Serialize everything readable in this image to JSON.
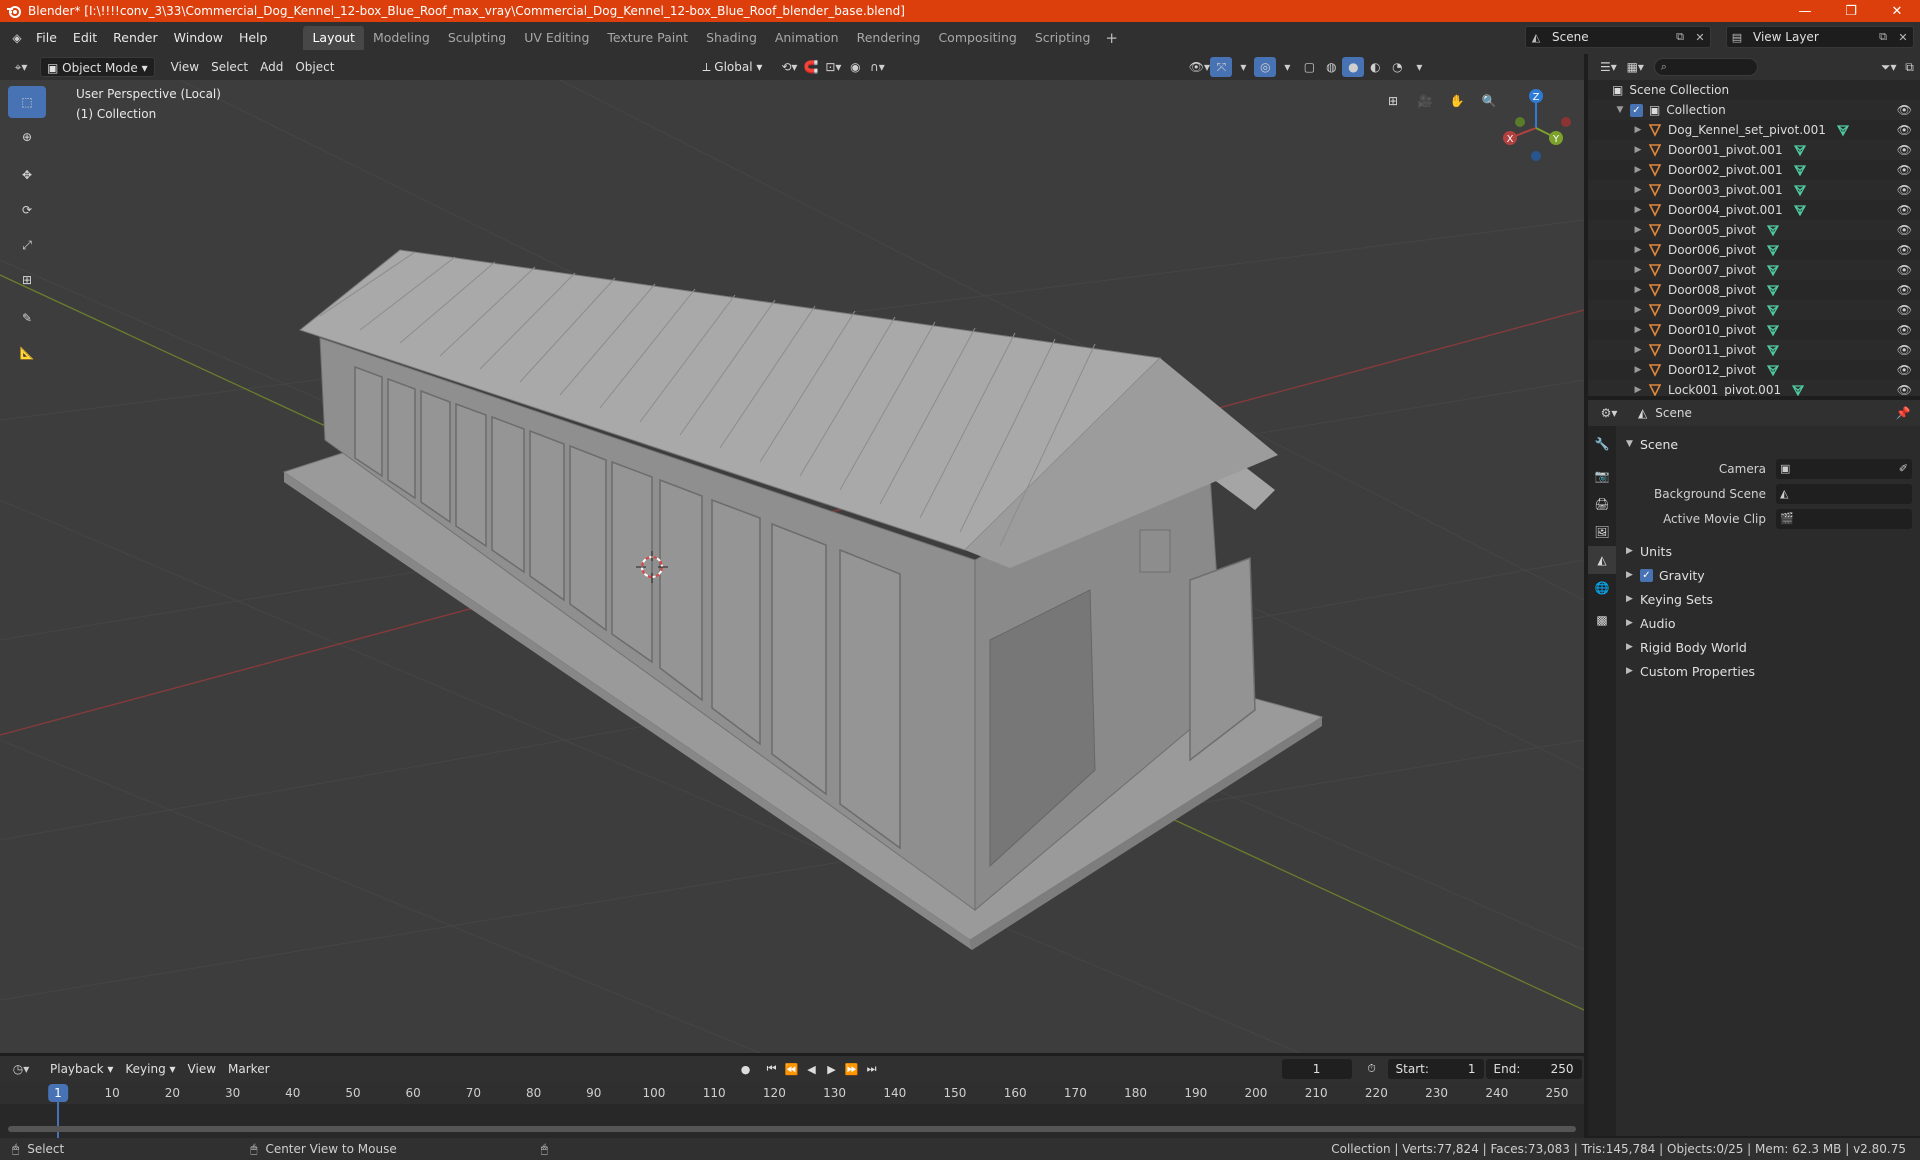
{
  "window": {
    "title": "Blender* [I:\\!!!!conv_3\\33\\Commercial_Dog_Kennel_12-box_Blue_Roof_max_vray\\Commercial_Dog_Kennel_12-box_Blue_Roof_blender_base.blend]",
    "controls": [
      "minimize",
      "maximize",
      "close"
    ]
  },
  "menubar": {
    "menus": [
      "File",
      "Edit",
      "Render",
      "Window",
      "Help"
    ],
    "workspaces": [
      "Layout",
      "Modeling",
      "Sculpting",
      "UV Editing",
      "Texture Paint",
      "Shading",
      "Animation",
      "Rendering",
      "Compositing",
      "Scripting"
    ],
    "active_workspace": "Layout",
    "scene": "Scene",
    "view_layer": "View Layer"
  },
  "viewport_header": {
    "mode": "Object Mode",
    "menus": [
      "View",
      "Select",
      "Add",
      "Object"
    ],
    "transform_orientation": "Global"
  },
  "viewport": {
    "perspective_label": "User Perspective (Local)",
    "collection_label": "(1) Collection",
    "tools": [
      "select-box",
      "cursor",
      "move",
      "rotate",
      "scale",
      "transform",
      "annotate",
      "measure"
    ],
    "gizmo_axes": [
      "X",
      "Y",
      "Z"
    ],
    "colors": {
      "background": "#3d3d3d",
      "x_axis": "#b3413f",
      "y_axis": "#7da22c",
      "z_axis": "#2e7bd6",
      "active": "#4772b3"
    }
  },
  "outliner": {
    "search_placeholder": "",
    "root": "Scene Collection",
    "collection": "Collection",
    "items": [
      "Dog_Kennel_set_pivot.001",
      "Door001_pivot.001",
      "Door002_pivot.001",
      "Door003_pivot.001",
      "Door004_pivot.001",
      "Door005_pivot",
      "Door006_pivot",
      "Door007_pivot",
      "Door008_pivot",
      "Door009_pivot",
      "Door010_pivot",
      "Door011_pivot",
      "Door012_pivot",
      "Lock001_pivot.001"
    ]
  },
  "properties": {
    "context": "Scene",
    "panel": "Scene",
    "fields": [
      {
        "label": "Camera"
      },
      {
        "label": "Background Scene"
      },
      {
        "label": "Active Movie Clip"
      }
    ],
    "subpanels": [
      "Units",
      "Gravity",
      "Keying Sets",
      "Audio",
      "Rigid Body World",
      "Custom Properties"
    ],
    "gravity_enabled": true
  },
  "timeline": {
    "menus": [
      "Playback",
      "Keying",
      "View",
      "Marker"
    ],
    "current_frame": "1",
    "start_label": "Start:",
    "start": "1",
    "end_label": "End:",
    "end": "250",
    "ticks": [
      "10",
      "20",
      "30",
      "40",
      "50",
      "60",
      "70",
      "80",
      "90",
      "100",
      "110",
      "120",
      "130",
      "140",
      "150",
      "160",
      "170",
      "180",
      "190",
      "200",
      "210",
      "220",
      "230",
      "240",
      "250"
    ]
  },
  "statusbar": {
    "left_action": "Select",
    "mid_action": "Center View to Mouse",
    "stats": "Collection | Verts:77,824 | Faces:73,083 | Tris:145,784 | Objects:0/25 | Mem: 62.3 MB | v2.80.75"
  }
}
